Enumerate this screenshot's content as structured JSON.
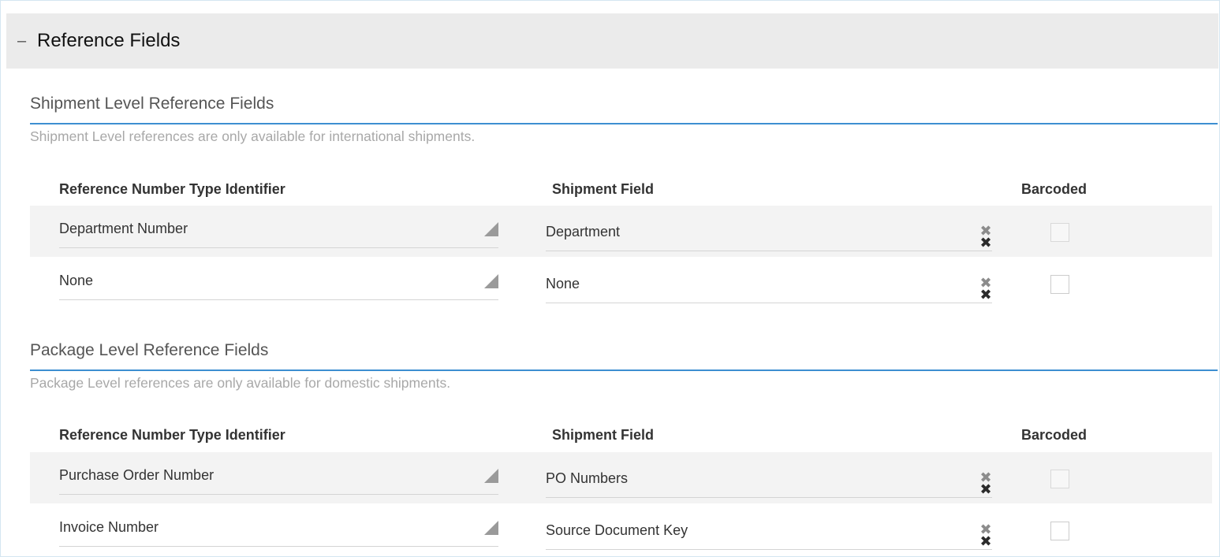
{
  "panel": {
    "toggle": "–",
    "title": "Reference Fields"
  },
  "shipment_level": {
    "title": "Shipment Level Reference Fields",
    "note": "Shipment Level references are only available for international shipments.",
    "columns": {
      "identifier": "Reference Number Type Identifier",
      "field": "Shipment Field",
      "barcoded": "Barcoded"
    },
    "rows": [
      {
        "identifier": "Department Number",
        "field": "Department",
        "barcoded": false
      },
      {
        "identifier": "None",
        "field": "None",
        "barcoded": false
      }
    ]
  },
  "package_level": {
    "title": "Package Level Reference Fields",
    "note": "Package Level references are only available for domestic shipments.",
    "columns": {
      "identifier": "Reference Number Type Identifier",
      "field": "Shipment Field",
      "barcoded": "Barcoded"
    },
    "rows": [
      {
        "identifier": "Purchase Order Number",
        "field": "PO Numbers",
        "barcoded": false
      },
      {
        "identifier": "Invoice Number",
        "field": "Source Document Key",
        "barcoded": false
      }
    ]
  },
  "icons": {
    "dropdown": "caret-triangle-icon",
    "clear": "clear-x-icon"
  },
  "colors": {
    "accent_rule": "#3d8fd1",
    "header_bg": "#ebebeb",
    "shaded_row": "#f3f3f3"
  }
}
